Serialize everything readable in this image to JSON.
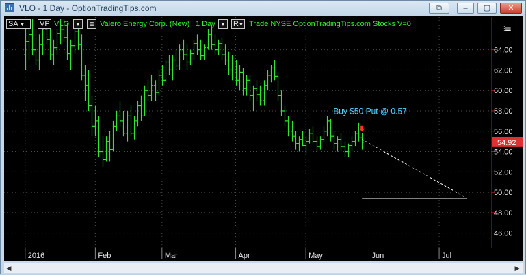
{
  "window": {
    "title": "VLO - 1 Day - OptionTradingTips.com",
    "buttons": {
      "restore": "⧉",
      "minimize": "–",
      "maximize": "▢",
      "close": "✕"
    }
  },
  "toolbar": {
    "sa_label": "SA",
    "vp_label": "VP",
    "symbol": "VLO",
    "company": "Valero Energy Corp. (New)",
    "interval": "1 Day",
    "mode": "R",
    "trade_info": "Trade  NYSE  OptionTradingTips.com  Stocks  V=0"
  },
  "annotation": {
    "text": "Buy $50 Put @ 0.57",
    "color": "#4fd4ff"
  },
  "last_price": "54.92",
  "colors": {
    "bars": "#2ee62e",
    "last_price_bg": "#e23030",
    "grid": "#4a4a4a",
    "axis_line": "#d01010",
    "signal_arrow": "#ff3030"
  },
  "chart_data": {
    "type": "ohlc",
    "y_ticks": [
      "46.00",
      "48.00",
      "50.00",
      "52.00",
      "54.00",
      "56.00",
      "58.00",
      "60.00",
      "62.00",
      "64.00"
    ],
    "ylim": [
      44.5,
      67.2
    ],
    "x_ticks": [
      {
        "label": "2016",
        "day": 0
      },
      {
        "label": "Feb",
        "day": 20
      },
      {
        "label": "Mar",
        "day": 39
      },
      {
        "label": "Apr",
        "day": 60
      },
      {
        "label": "May",
        "day": 80
      },
      {
        "label": "Jun",
        "day": 98
      },
      {
        "label": "Jul",
        "day": 118
      }
    ],
    "x_range": [
      -6,
      133
    ],
    "ohlc": [
      [
        63.5,
        66.5,
        62.0,
        64.8
      ],
      [
        64.8,
        67.0,
        63.0,
        65.5
      ],
      [
        65.5,
        67.0,
        63.5,
        64.0
      ],
      [
        64.0,
        66.0,
        62.5,
        63.0
      ],
      [
        63.0,
        65.5,
        62.0,
        64.5
      ],
      [
        64.5,
        66.5,
        63.5,
        66.0
      ],
      [
        66.0,
        67.0,
        64.5,
        65.0
      ],
      [
        65.0,
        66.5,
        63.0,
        63.5
      ],
      [
        63.5,
        65.0,
        62.5,
        64.2
      ],
      [
        64.2,
        66.0,
        63.5,
        65.6
      ],
      [
        65.6,
        67.0,
        64.5,
        66.0
      ],
      [
        66.0,
        67.0,
        64.8,
        65.2
      ],
      [
        65.2,
        66.6,
        63.0,
        63.6
      ],
      [
        63.6,
        65.0,
        62.0,
        64.4
      ],
      [
        64.4,
        66.2,
        63.6,
        65.8
      ],
      [
        65.8,
        67.0,
        64.0,
        64.5
      ],
      [
        64.5,
        65.5,
        61.0,
        61.5
      ],
      [
        61.5,
        62.5,
        59.0,
        60.5
      ],
      [
        60.5,
        62.0,
        58.0,
        58.5
      ],
      [
        58.5,
        59.5,
        55.5,
        56.5
      ],
      [
        56.5,
        58.5,
        55.5,
        57.0
      ],
      [
        57.0,
        57.5,
        53.5,
        54.0
      ],
      [
        54.0,
        55.5,
        52.5,
        53.2
      ],
      [
        53.2,
        55.5,
        53.0,
        55.0
      ],
      [
        55.0,
        56.0,
        53.0,
        54.2
      ],
      [
        54.2,
        57.0,
        54.0,
        56.5
      ],
      [
        56.5,
        58.0,
        56.0,
        57.5
      ],
      [
        57.5,
        59.0,
        56.5,
        57.0
      ],
      [
        57.0,
        58.0,
        55.5,
        55.8
      ],
      [
        55.8,
        58.0,
        55.0,
        57.5
      ],
      [
        57.5,
        58.5,
        55.5,
        55.8
      ],
      [
        55.8,
        57.5,
        55.2,
        57.0
      ],
      [
        57.0,
        59.0,
        56.5,
        58.5
      ],
      [
        58.5,
        59.5,
        57.0,
        57.5
      ],
      [
        57.5,
        60.5,
        57.5,
        60.0
      ],
      [
        60.0,
        61.0,
        59.0,
        59.5
      ],
      [
        59.5,
        61.5,
        59.0,
        60.5
      ],
      [
        60.5,
        61.0,
        59.0,
        59.8
      ],
      [
        59.8,
        62.0,
        59.5,
        61.5
      ],
      [
        61.5,
        62.5,
        60.5,
        61.0
      ],
      [
        61.0,
        63.0,
        60.8,
        62.8
      ],
      [
        62.8,
        63.5,
        61.5,
        62.0
      ],
      [
        62.0,
        63.5,
        61.0,
        63.0
      ],
      [
        63.0,
        64.0,
        62.0,
        62.4
      ],
      [
        62.4,
        64.5,
        62.0,
        64.0
      ],
      [
        64.0,
        65.0,
        63.0,
        63.5
      ],
      [
        63.5,
        64.5,
        62.0,
        62.8
      ],
      [
        62.8,
        64.0,
        62.5,
        63.6
      ],
      [
        63.6,
        65.0,
        63.0,
        64.6
      ],
      [
        64.6,
        65.5,
        63.5,
        64.0
      ],
      [
        64.0,
        65.0,
        63.0,
        63.4
      ],
      [
        63.4,
        64.5,
        63.0,
        64.2
      ],
      [
        64.2,
        66.0,
        64.0,
        65.5
      ],
      [
        65.5,
        66.5,
        64.0,
        64.5
      ],
      [
        64.5,
        65.5,
        63.5,
        64.0
      ],
      [
        64.0,
        65.0,
        63.5,
        64.6
      ],
      [
        64.6,
        65.2,
        63.0,
        63.5
      ],
      [
        63.5,
        64.5,
        62.5,
        63.0
      ],
      [
        63.0,
        63.8,
        61.5,
        62.0
      ],
      [
        62.0,
        63.5,
        61.0,
        62.6
      ],
      [
        62.6,
        63.0,
        60.5,
        61.0
      ],
      [
        61.0,
        62.5,
        60.0,
        61.8
      ],
      [
        61.8,
        62.2,
        59.5,
        60.2
      ],
      [
        60.2,
        61.5,
        59.5,
        61.0
      ],
      [
        61.0,
        61.5,
        59.0,
        59.5
      ],
      [
        59.5,
        60.5,
        58.0,
        60.2
      ],
      [
        60.2,
        61.0,
        59.0,
        59.6
      ],
      [
        59.6,
        60.5,
        58.5,
        59.0
      ],
      [
        59.0,
        61.0,
        58.5,
        60.5
      ],
      [
        60.5,
        62.0,
        60.0,
        61.5
      ],
      [
        61.5,
        62.5,
        60.8,
        62.2
      ],
      [
        62.2,
        63.0,
        61.0,
        61.4
      ],
      [
        61.4,
        61.8,
        59.0,
        59.5
      ],
      [
        59.5,
        60.0,
        57.5,
        58.0
      ],
      [
        58.0,
        58.5,
        56.5,
        57.0
      ],
      [
        57.0,
        57.5,
        55.5,
        56.0
      ],
      [
        56.0,
        57.0,
        55.0,
        55.5
      ],
      [
        55.5,
        56.0,
        54.2,
        54.8
      ],
      [
        54.8,
        55.5,
        54.0,
        55.2
      ],
      [
        55.2,
        56.0,
        54.5,
        54.6
      ],
      [
        54.6,
        55.5,
        53.8,
        55.0
      ],
      [
        55.0,
        56.2,
        54.8,
        55.8
      ],
      [
        55.8,
        56.5,
        54.8,
        55.0
      ],
      [
        55.0,
        55.5,
        54.0,
        54.5
      ],
      [
        54.5,
        55.5,
        54.2,
        55.2
      ],
      [
        55.2,
        56.5,
        55.0,
        56.0
      ],
      [
        56.0,
        57.5,
        55.5,
        57.0
      ],
      [
        57.0,
        57.2,
        55.0,
        55.5
      ],
      [
        55.5,
        56.0,
        54.2,
        54.8
      ],
      [
        54.8,
        55.5,
        54.0,
        55.2
      ],
      [
        55.2,
        55.8,
        54.0,
        54.5
      ],
      [
        54.5,
        55.0,
        53.5,
        54.0
      ],
      [
        54.0,
        54.8,
        53.5,
        54.6
      ],
      [
        54.6,
        55.5,
        54.0,
        55.0
      ],
      [
        55.0,
        56.0,
        54.5,
        55.8
      ],
      [
        55.8,
        56.8,
        55.0,
        55.4
      ],
      [
        55.4,
        55.8,
        54.2,
        54.92
      ]
    ],
    "forecast_line": {
      "from": [
        96,
        55.2
      ],
      "to": [
        126,
        49.4
      ],
      "style": "dashed"
    },
    "target_line": {
      "from": [
        96,
        49.4
      ],
      "to": [
        126,
        49.4
      ],
      "price": 49.4
    }
  }
}
